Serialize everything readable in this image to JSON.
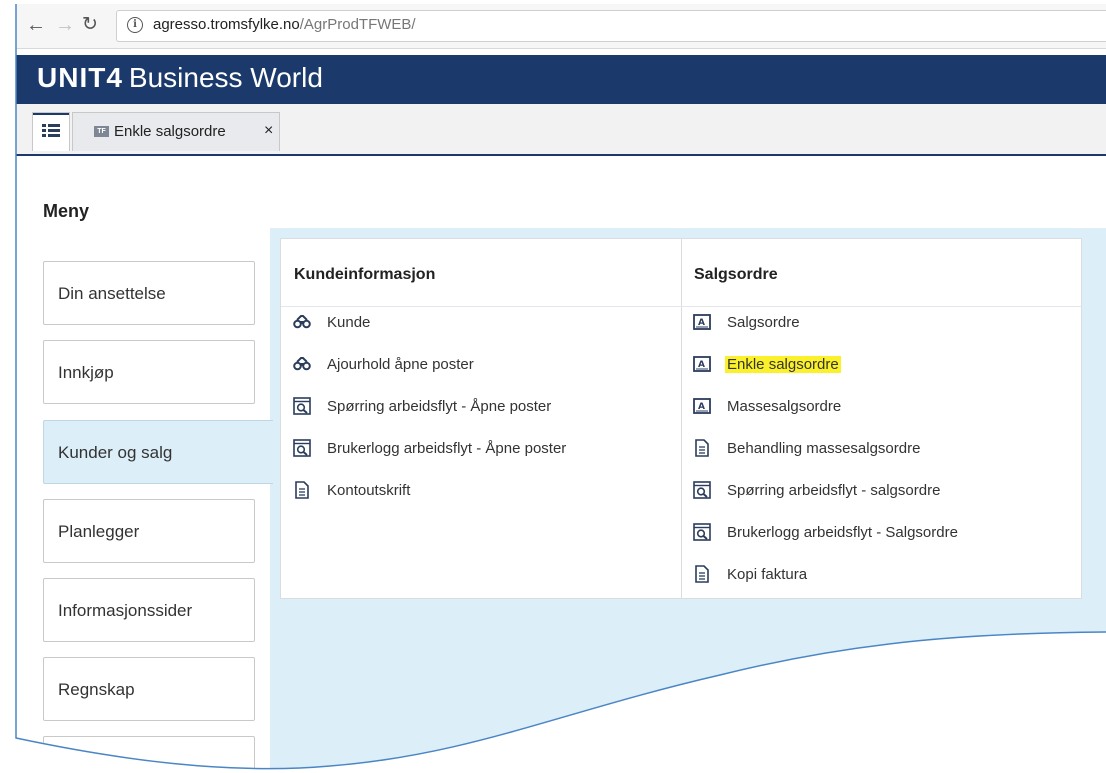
{
  "browser": {
    "url_host": "agresso.tromsfylke.no",
    "url_path": "/AgrProdTFWEB/"
  },
  "app": {
    "logo_unit": "UNIT4",
    "logo_product": "Business World"
  },
  "tabs": {
    "menu_tab_icon": "list-icon",
    "active_tab_badge": "TF",
    "active_tab_label": "Enkle salgsordre",
    "close_glyph": "×"
  },
  "menu": {
    "title": "Meny",
    "items": [
      {
        "label": "Din ansettelse",
        "active": false
      },
      {
        "label": "Innkjøp",
        "active": false
      },
      {
        "label": "Kunder og salg",
        "active": true
      },
      {
        "label": "Planlegger",
        "active": false
      },
      {
        "label": "Informasjonssider",
        "active": false
      },
      {
        "label": "Regnskap",
        "active": false
      },
      {
        "label": "",
        "active": false
      }
    ]
  },
  "submenu": {
    "columns": [
      {
        "header": "Kundeinformasjon",
        "items": [
          {
            "label": "Kunde",
            "icon": "binoculars-icon"
          },
          {
            "label": "Ajourhold åpne poster",
            "icon": "binoculars-icon"
          },
          {
            "label": "Spørring arbeidsflyt - Åpne poster",
            "icon": "query-icon"
          },
          {
            "label": "Brukerlogg arbeidsflyt - Åpne poster",
            "icon": "query-icon"
          },
          {
            "label": "Kontoutskrift",
            "icon": "document-icon"
          }
        ]
      },
      {
        "header": "Salgsordre",
        "items": [
          {
            "label": "Salgsordre",
            "icon": "form-icon"
          },
          {
            "label": "Enkle salgsordre",
            "icon": "form-icon",
            "highlighted": true
          },
          {
            "label": "Massesalgsordre",
            "icon": "form-icon"
          },
          {
            "label": "Behandling massesalgsordre",
            "icon": "document-icon"
          },
          {
            "label": "Spørring arbeidsflyt - salgsordre",
            "icon": "query-icon"
          },
          {
            "label": "Brukerlogg arbeidsflyt - Salgsordre",
            "icon": "query-icon"
          },
          {
            "label": "Kopi faktura",
            "icon": "document-icon"
          }
        ]
      }
    ]
  },
  "colors": {
    "header_bg": "#1b3a6b",
    "active_menu_bg": "#dceef7",
    "highlight": "#fbf12a"
  }
}
